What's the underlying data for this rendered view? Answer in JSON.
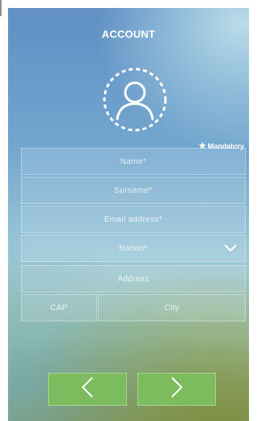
{
  "header": {
    "title": "ACCOUNT"
  },
  "avatar": {
    "icon": "user-avatar-icon"
  },
  "legend": {
    "star_icon": "star-icon",
    "mandatory_label": "Mandatory"
  },
  "form": {
    "name_placeholder": "Name*",
    "surname_placeholder": "Surname*",
    "email_placeholder": "Email address*",
    "nation_placeholder": "Nation*",
    "address_placeholder": "Address",
    "cap_placeholder": "CAP",
    "city_placeholder": "City"
  },
  "nav": {
    "back_icon": "chevron-left-icon",
    "next_icon": "chevron-right-icon"
  },
  "colors": {
    "button_green": "#7dbb5f",
    "text_white": "#ffffff"
  }
}
